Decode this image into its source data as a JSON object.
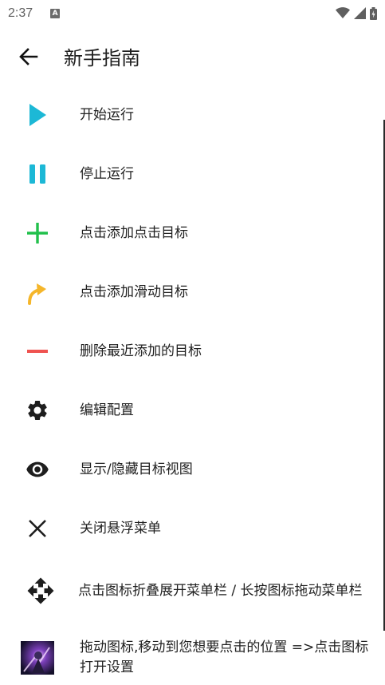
{
  "status_bar": {
    "time": "2:37",
    "notification_icon": "A"
  },
  "appbar": {
    "back_icon": "arrow-left-icon",
    "title": "新手指南"
  },
  "guide_items": [
    {
      "icon": "play-icon",
      "label": "开始运行"
    },
    {
      "icon": "pause-icon",
      "label": "停止运行"
    },
    {
      "icon": "plus-icon",
      "label": "点击添加点击目标"
    },
    {
      "icon": "swipe-arrow-icon",
      "label": "点击添加滑动目标"
    },
    {
      "icon": "minus-icon",
      "label": "删除最近添加的目标"
    },
    {
      "icon": "gear-icon",
      "label": "编辑配置"
    },
    {
      "icon": "eye-icon",
      "label": "显示/隐藏目标视图"
    },
    {
      "icon": "close-icon",
      "label": "关闭悬浮菜单"
    },
    {
      "icon": "move-icon",
      "label": "点击图标折叠展开菜单栏 / 长按图标拖动菜单栏"
    },
    {
      "icon": "app-thumbnail-icon",
      "label": "拖动图标,移动到您想要点击的位置 =>点击图标打开设置"
    }
  ],
  "colors": {
    "play": "#1cb8d6",
    "pause": "#1cb8d6",
    "plus": "#21c04b",
    "swipe": "#f5b62a",
    "minus": "#ef5350",
    "dark_icon": "#1e1e1e"
  }
}
